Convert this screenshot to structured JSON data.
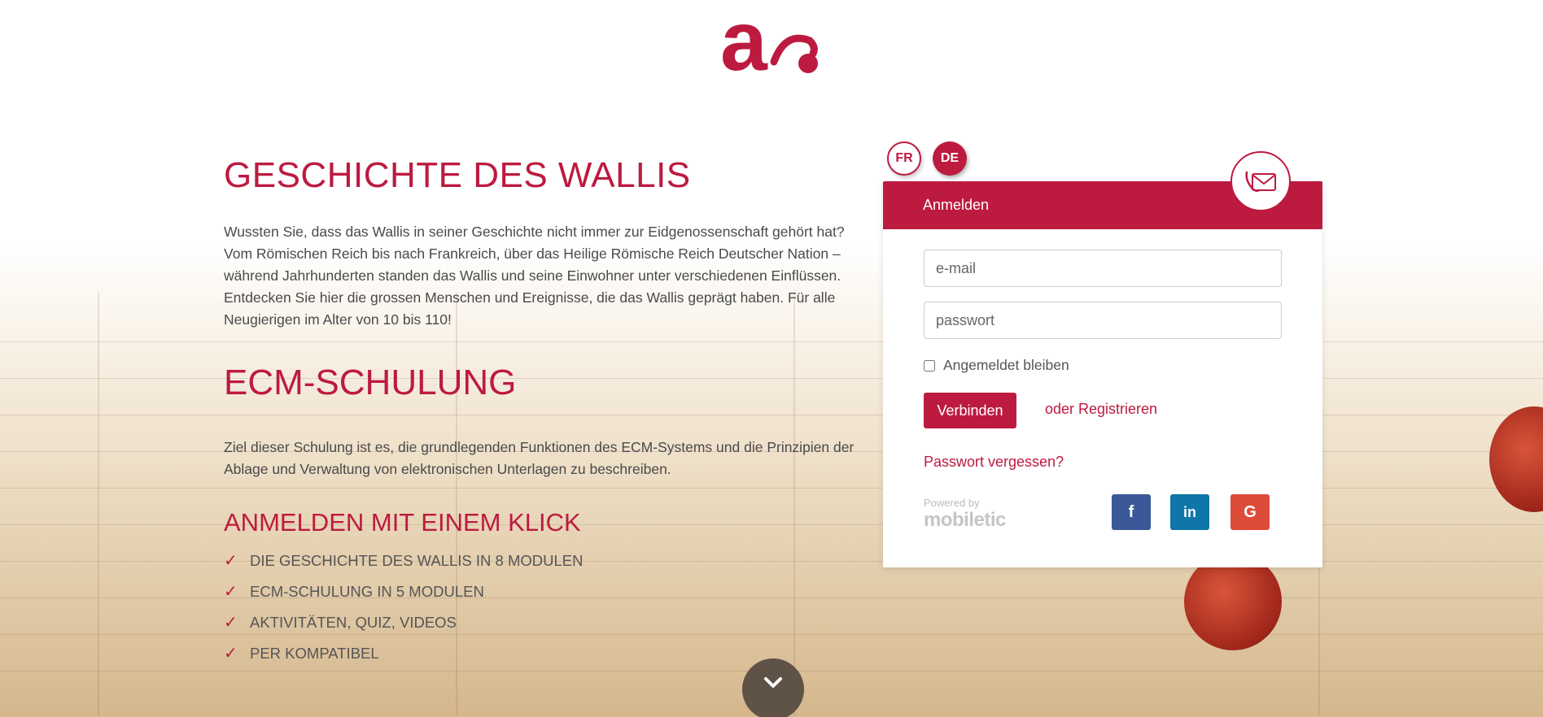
{
  "section1": {
    "title": "GESCHICHTE DES WALLIS",
    "text": "Wussten Sie, dass das Wallis in seiner Geschichte nicht immer zur Eidgenossenschaft gehört hat? Vom Römischen Reich bis nach Frankreich, über das Heilige Römische Reich Deutscher Nation – während Jahrhunderten standen das Wallis und seine Einwohner unter verschiedenen Einflüssen. Entdecken Sie hier die grossen Menschen und Ereignisse, die das Wallis geprägt haben. Für alle Neugierigen im Alter von 10 bis 110!"
  },
  "section2": {
    "title": "ECM-SCHULUNG",
    "text": "Ziel dieser Schulung ist es, die grundlegenden Funktionen des ECM-Systems und die Prinzipien der Ablage und Verwaltung von elektronischen Unterlagen zu beschreiben."
  },
  "section3": {
    "title": "ANMELDEN MIT EINEM KLICK",
    "items": [
      "DIE GESCHICHTE DES WALLIS IN 8 MODULEN",
      "ECM-SCHULUNG IN 5 MODULEN",
      "AKTIVITÄTEN, QUIZ, VIDEOS",
      "PER KOMPATIBEL"
    ]
  },
  "languages": {
    "fr": "FR",
    "de": "DE",
    "active": "DE"
  },
  "login": {
    "header": "Anmelden",
    "email_placeholder": "e-mail",
    "password_placeholder": "passwort",
    "remember_label": "Angemeldet bleiben",
    "connect_button": "Verbinden",
    "register_link": "oder Registrieren",
    "forgot_link": "Passwort vergessen?",
    "powered_by": "Powered by",
    "powered_brand": "mobiletic",
    "social": {
      "facebook": "f",
      "linkedin": "in",
      "google": "G"
    }
  },
  "colors": {
    "accent": "#bd1a40",
    "facebook": "#3b5998",
    "linkedin": "#0e76a8",
    "google": "#dd4b39"
  },
  "icons": {
    "logo": "a-logo",
    "mail": "envelope-phone-icon",
    "check": "check-icon",
    "scroll": "chevron-down-icon"
  }
}
